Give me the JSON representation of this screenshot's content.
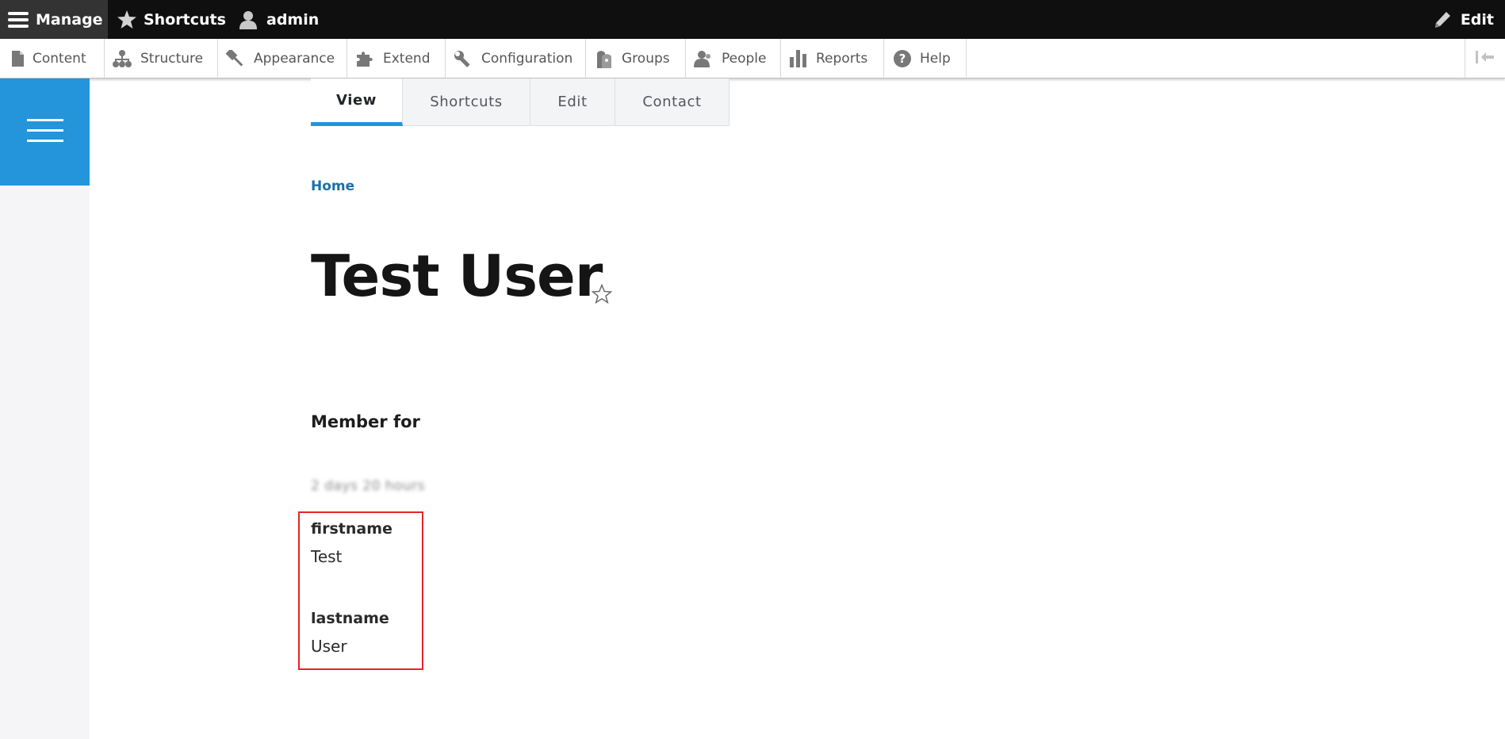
{
  "toolbar": {
    "manage_label": "Manage",
    "shortcuts_label": "Shortcuts",
    "user_label": "admin",
    "edit_label": "Edit"
  },
  "tray": {
    "items": [
      {
        "label": "Content",
        "icon": "file-icon"
      },
      {
        "label": "Structure",
        "icon": "sitemap-icon"
      },
      {
        "label": "Appearance",
        "icon": "brush-icon"
      },
      {
        "label": "Extend",
        "icon": "puzzle-icon"
      },
      {
        "label": "Configuration",
        "icon": "wrench-icon"
      },
      {
        "label": "Groups",
        "icon": "groups-icon"
      },
      {
        "label": "People",
        "icon": "people-icon"
      },
      {
        "label": "Reports",
        "icon": "bar-chart-icon"
      },
      {
        "label": "Help",
        "icon": "help-icon"
      }
    ]
  },
  "local_tabs": [
    {
      "label": "View",
      "active": true
    },
    {
      "label": "Shortcuts",
      "active": false
    },
    {
      "label": "Edit",
      "active": false
    },
    {
      "label": "Contact",
      "active": false
    }
  ],
  "breadcrumb": {
    "home": "Home"
  },
  "page": {
    "title": "Test User"
  },
  "profile": {
    "member_for_label": "Member for",
    "member_for_value": "2 days 20 hours",
    "fields": [
      {
        "label": "firstname",
        "value": "Test"
      },
      {
        "label": "lastname",
        "value": "User"
      }
    ]
  },
  "colors": {
    "toolbar_bg": "#0f0f0f",
    "accent": "#2494db",
    "link": "#1f6fa8",
    "highlight_border": "#e3242b"
  }
}
